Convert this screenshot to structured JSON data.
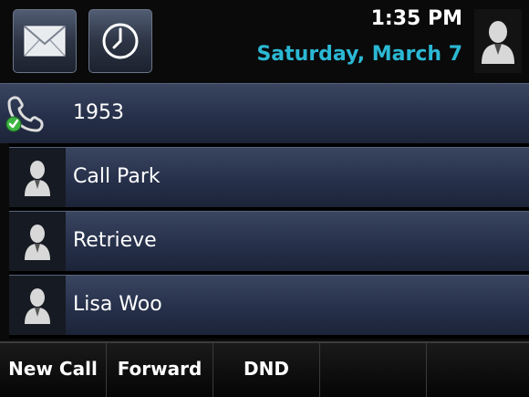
{
  "status_bar": {
    "messages_icon": "envelope-icon",
    "recent_icon": "clock-icon",
    "time": "1:35 PM",
    "date": "Saturday, March 7",
    "avatar_icon": "person-icon"
  },
  "lines": [
    {
      "label": "1953",
      "icon": "phone-registered-icon"
    },
    {
      "label": "Call Park",
      "icon": "contact-icon"
    },
    {
      "label": "Retrieve",
      "icon": "contact-icon"
    },
    {
      "label": "Lisa Woo",
      "icon": "contact-icon"
    }
  ],
  "softkeys": [
    "New Call",
    "Forward",
    "DND",
    ""
  ],
  "colors": {
    "date": "#2bb8d4",
    "line_bg": "#26304a",
    "background": "#0a0a0a"
  }
}
